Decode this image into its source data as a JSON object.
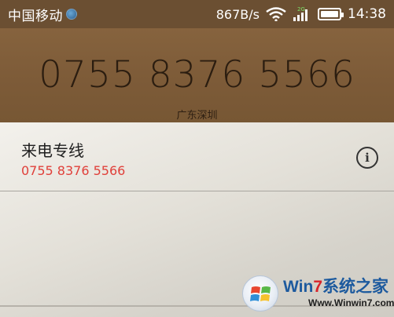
{
  "status_bar": {
    "carrier": "中国移动",
    "network_speed": "867B/s",
    "network_type": "2G",
    "time": "14:38"
  },
  "caller_header": {
    "number": "0755 8376 5566",
    "location": "广东深圳"
  },
  "caller_entry": {
    "name": "来电专线",
    "number": "0755 8376 5566"
  },
  "watermark": {
    "brand_prefix": "Win",
    "brand_seven": "7",
    "brand_suffix": "系统之家",
    "url": "Www.Winwin7.com"
  },
  "colors": {
    "status_bar_bg": "#6b4f32",
    "header_bg": "#86633e",
    "number_text": "#2b1d10",
    "caller_number_red": "#e0403a"
  },
  "icons": {
    "globe": "globe-icon",
    "wifi": "wifi-icon",
    "signal": "signal-icon",
    "battery": "battery-icon",
    "info": "info-icon",
    "windows_logo": "windows-logo-icon"
  }
}
